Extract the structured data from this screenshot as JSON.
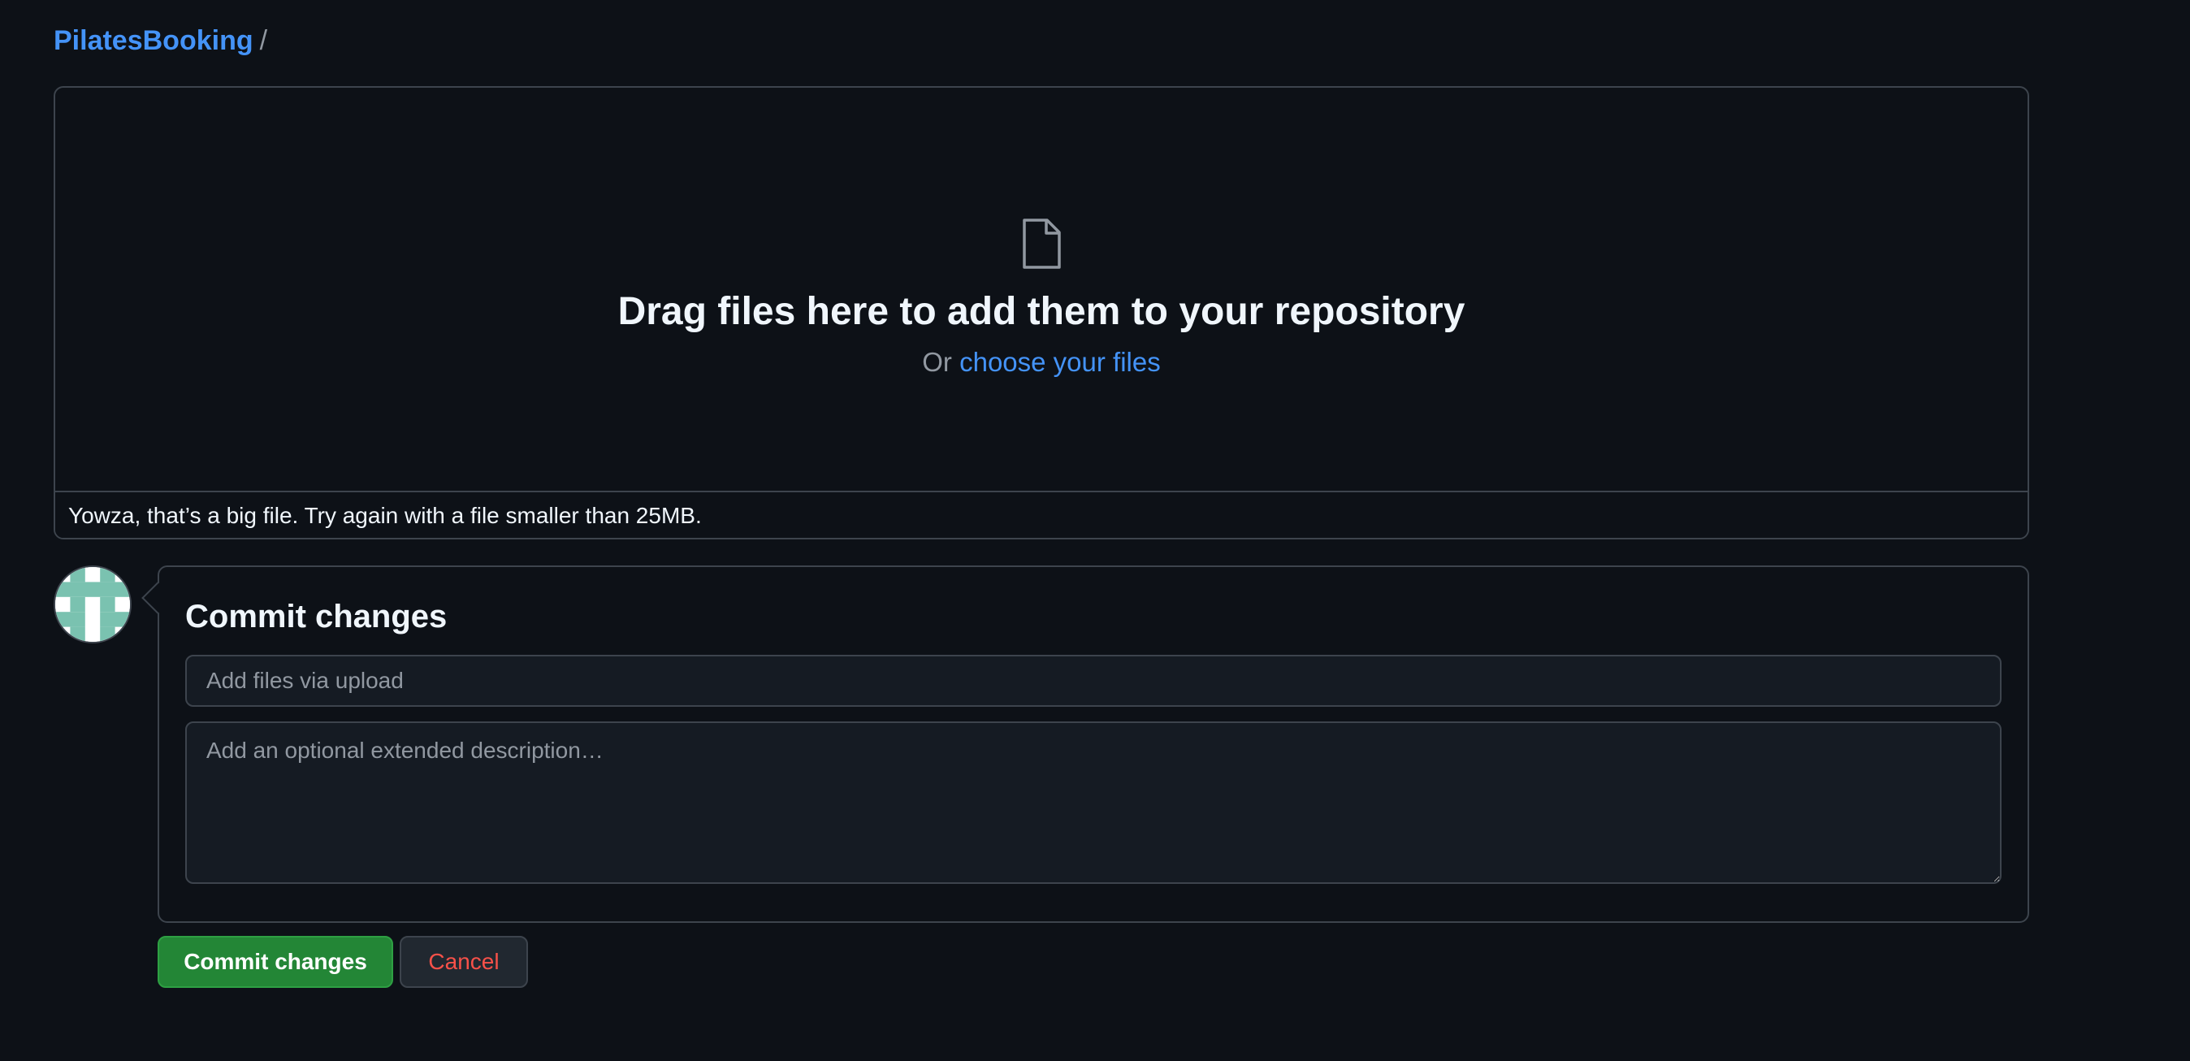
{
  "breadcrumb": {
    "repo_name": "PilatesBooking",
    "separator": "/"
  },
  "dropzone": {
    "icon": "file-icon",
    "title": "Drag files here to add them to your repository",
    "or_text": "Or",
    "choose_link": "choose your files",
    "error_message": "Yowza, that’s a big file. Try again with a file smaller than 25MB."
  },
  "commit": {
    "title": "Commit changes",
    "summary_placeholder": "Add files via upload",
    "summary_value": "",
    "description_placeholder": "Add an optional extended description…",
    "description_value": ""
  },
  "actions": {
    "commit_label": "Commit changes",
    "cancel_label": "Cancel"
  },
  "colors": {
    "background": "#0d1117",
    "link": "#4493f8",
    "primary_button": "#238636",
    "danger_text": "#f85149",
    "avatar_accent": "#7ac2b0"
  }
}
